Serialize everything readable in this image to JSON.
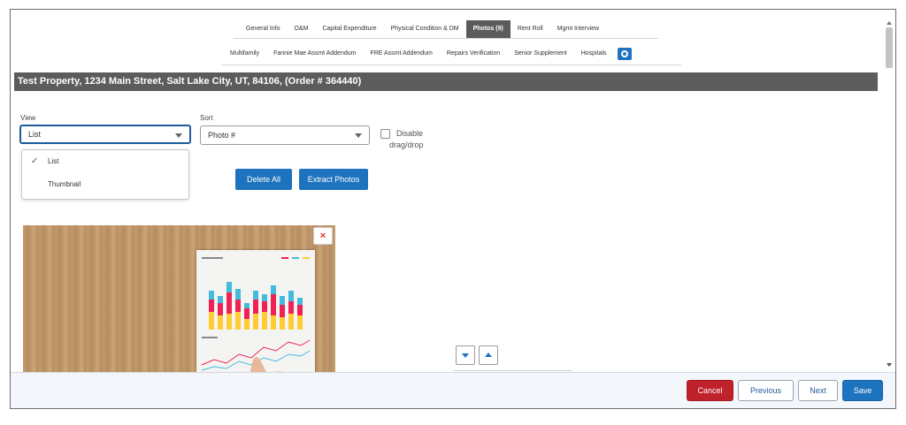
{
  "tabs_row1": [
    "General Info",
    "O&M",
    "Capital Expenditure",
    "Physical Condition & DM",
    "Photos (9)",
    "Rent Roll",
    "Mgmt Interview"
  ],
  "tabs_row2": [
    "Multifamily",
    "Fannie Mae Assmt Addendum",
    "FRE Assmt Addendum",
    "Repairs Verification",
    "Senior Supplement",
    "Hospitals"
  ],
  "active_tab": "Photos (9)",
  "property_title": "Test Property, 1234 Main Street, Salt Lake City, UT, 84106, (Order # 364440)",
  "view": {
    "label": "View",
    "value": "List",
    "options": [
      "List",
      "Thumbnail"
    ],
    "selected": "List"
  },
  "sort": {
    "label": "Sort",
    "value": "Photo #"
  },
  "disable_dragdrop": {
    "label_line1": "Disable",
    "label_line2": "drag/drop",
    "checked": false
  },
  "buttons": {
    "delete_all": "Delete All",
    "extract_photos": "Extract Photos"
  },
  "photo": {
    "delete_glyph": "×"
  },
  "footer": {
    "cancel": "Cancel",
    "previous": "Previous",
    "next": "Next",
    "save": "Save"
  },
  "colors": {
    "primary": "#1e73be",
    "danger": "#c0222b",
    "header_bar": "#5c5c5c"
  }
}
